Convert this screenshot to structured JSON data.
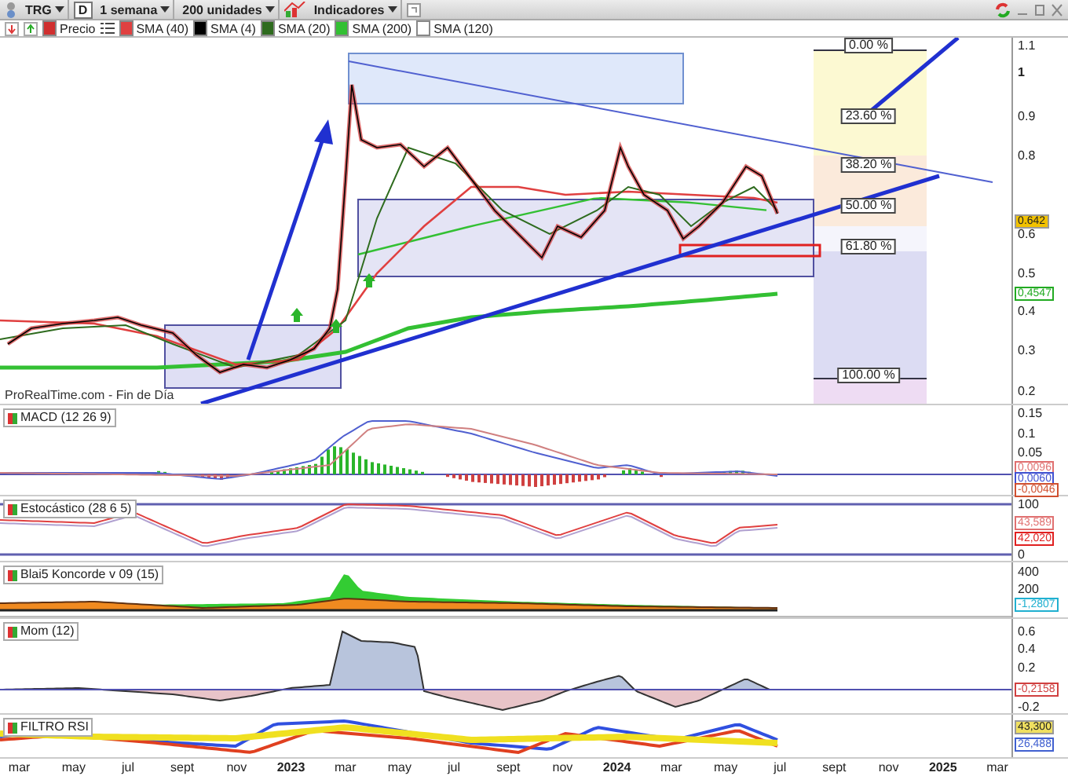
{
  "toolbar": {
    "symbol": "TRG",
    "symbol_badge": "D",
    "period": "1 semana",
    "units": "200 unidades",
    "indicators": "Indicadores"
  },
  "legend": [
    {
      "label": "Precio",
      "kind": "price",
      "color": "#d03030"
    },
    {
      "label": "SMA (40)",
      "kind": "sma",
      "color": "#e04040"
    },
    {
      "label": "SMA (4)",
      "kind": "sma",
      "color": "#000000"
    },
    {
      "label": "SMA (20)",
      "kind": "sma",
      "color": "#2e6b1e"
    },
    {
      "label": "SMA (200)",
      "kind": "sma",
      "color": "#33c033"
    },
    {
      "label": "SMA (120)",
      "kind": "sma",
      "color": "#ffffff"
    }
  ],
  "panels": [
    {
      "kind": "price",
      "watermark": "ProRealTime.com - Fin de Día",
      "fib_levels": [
        "0.00 %",
        "23.60 %",
        "38.20 %",
        "50.00 %",
        "61.80 %",
        "100.00 %"
      ],
      "ticks": [
        "1.1",
        "1",
        "0.9",
        "0.8",
        "0.6",
        "0.5",
        "0.4",
        "0.3",
        "0.2"
      ],
      "badges": [
        {
          "text": "0.642",
          "kind": "filled",
          "color": "#f2c200"
        },
        {
          "text": "0,4547",
          "kind": "outline",
          "color": "#22aa22"
        }
      ]
    },
    {
      "kind": "macd",
      "label": "MACD (12 26 9)",
      "ticks": [
        "0.15",
        "0.1",
        "0.05"
      ],
      "badges": [
        {
          "text": "0,0096",
          "kind": "outline",
          "color": "#e07070"
        },
        {
          "text": "0,0060",
          "kind": "outline",
          "color": "#4050d0"
        },
        {
          "text": "-0,0046",
          "kind": "outline",
          "color": "#d05030"
        }
      ]
    },
    {
      "kind": "stochastic",
      "label": "Estocástico (28 6 5)",
      "ticks": [
        "100",
        "0"
      ],
      "badges": [
        {
          "text": "43,589",
          "kind": "outline",
          "color": "#e07070"
        },
        {
          "text": "42,020",
          "kind": "outline",
          "color": "#e02020"
        }
      ]
    },
    {
      "kind": "koncorde",
      "label": "Blai5 Koncorde v 09 (15)",
      "ticks": [
        "400",
        "200"
      ],
      "badges": [
        {
          "text": "-1,2807",
          "kind": "outline",
          "color": "#20b0d0"
        }
      ]
    },
    {
      "kind": "momentum",
      "label": "Mom (12)",
      "ticks": [
        "0.6",
        "0.4",
        "0.2",
        "-0.2"
      ],
      "badges": [
        {
          "text": "-0,2158",
          "kind": "outline",
          "color": "#d04040"
        }
      ]
    },
    {
      "kind": "rsi",
      "label": "FILTRO RSI",
      "badges": [
        {
          "text": "43,300",
          "kind": "filled",
          "color": "#f0e060"
        },
        {
          "text": "26,488",
          "kind": "outline",
          "color": "#4060d0"
        }
      ]
    }
  ],
  "time_axis": [
    {
      "label": "mar",
      "kind": "month"
    },
    {
      "label": "may",
      "kind": "month"
    },
    {
      "label": "jul",
      "kind": "month"
    },
    {
      "label": "sept",
      "kind": "month"
    },
    {
      "label": "nov",
      "kind": "month"
    },
    {
      "label": "2023",
      "kind": "year"
    },
    {
      "label": "mar",
      "kind": "month"
    },
    {
      "label": "may",
      "kind": "month"
    },
    {
      "label": "jul",
      "kind": "month"
    },
    {
      "label": "sept",
      "kind": "month"
    },
    {
      "label": "nov",
      "kind": "month"
    },
    {
      "label": "2024",
      "kind": "year"
    },
    {
      "label": "mar",
      "kind": "month"
    },
    {
      "label": "may",
      "kind": "month"
    },
    {
      "label": "jul",
      "kind": "month"
    },
    {
      "label": "sept",
      "kind": "month"
    },
    {
      "label": "nov",
      "kind": "month"
    },
    {
      "label": "2025",
      "kind": "year"
    },
    {
      "label": "mar",
      "kind": "month"
    }
  ]
}
